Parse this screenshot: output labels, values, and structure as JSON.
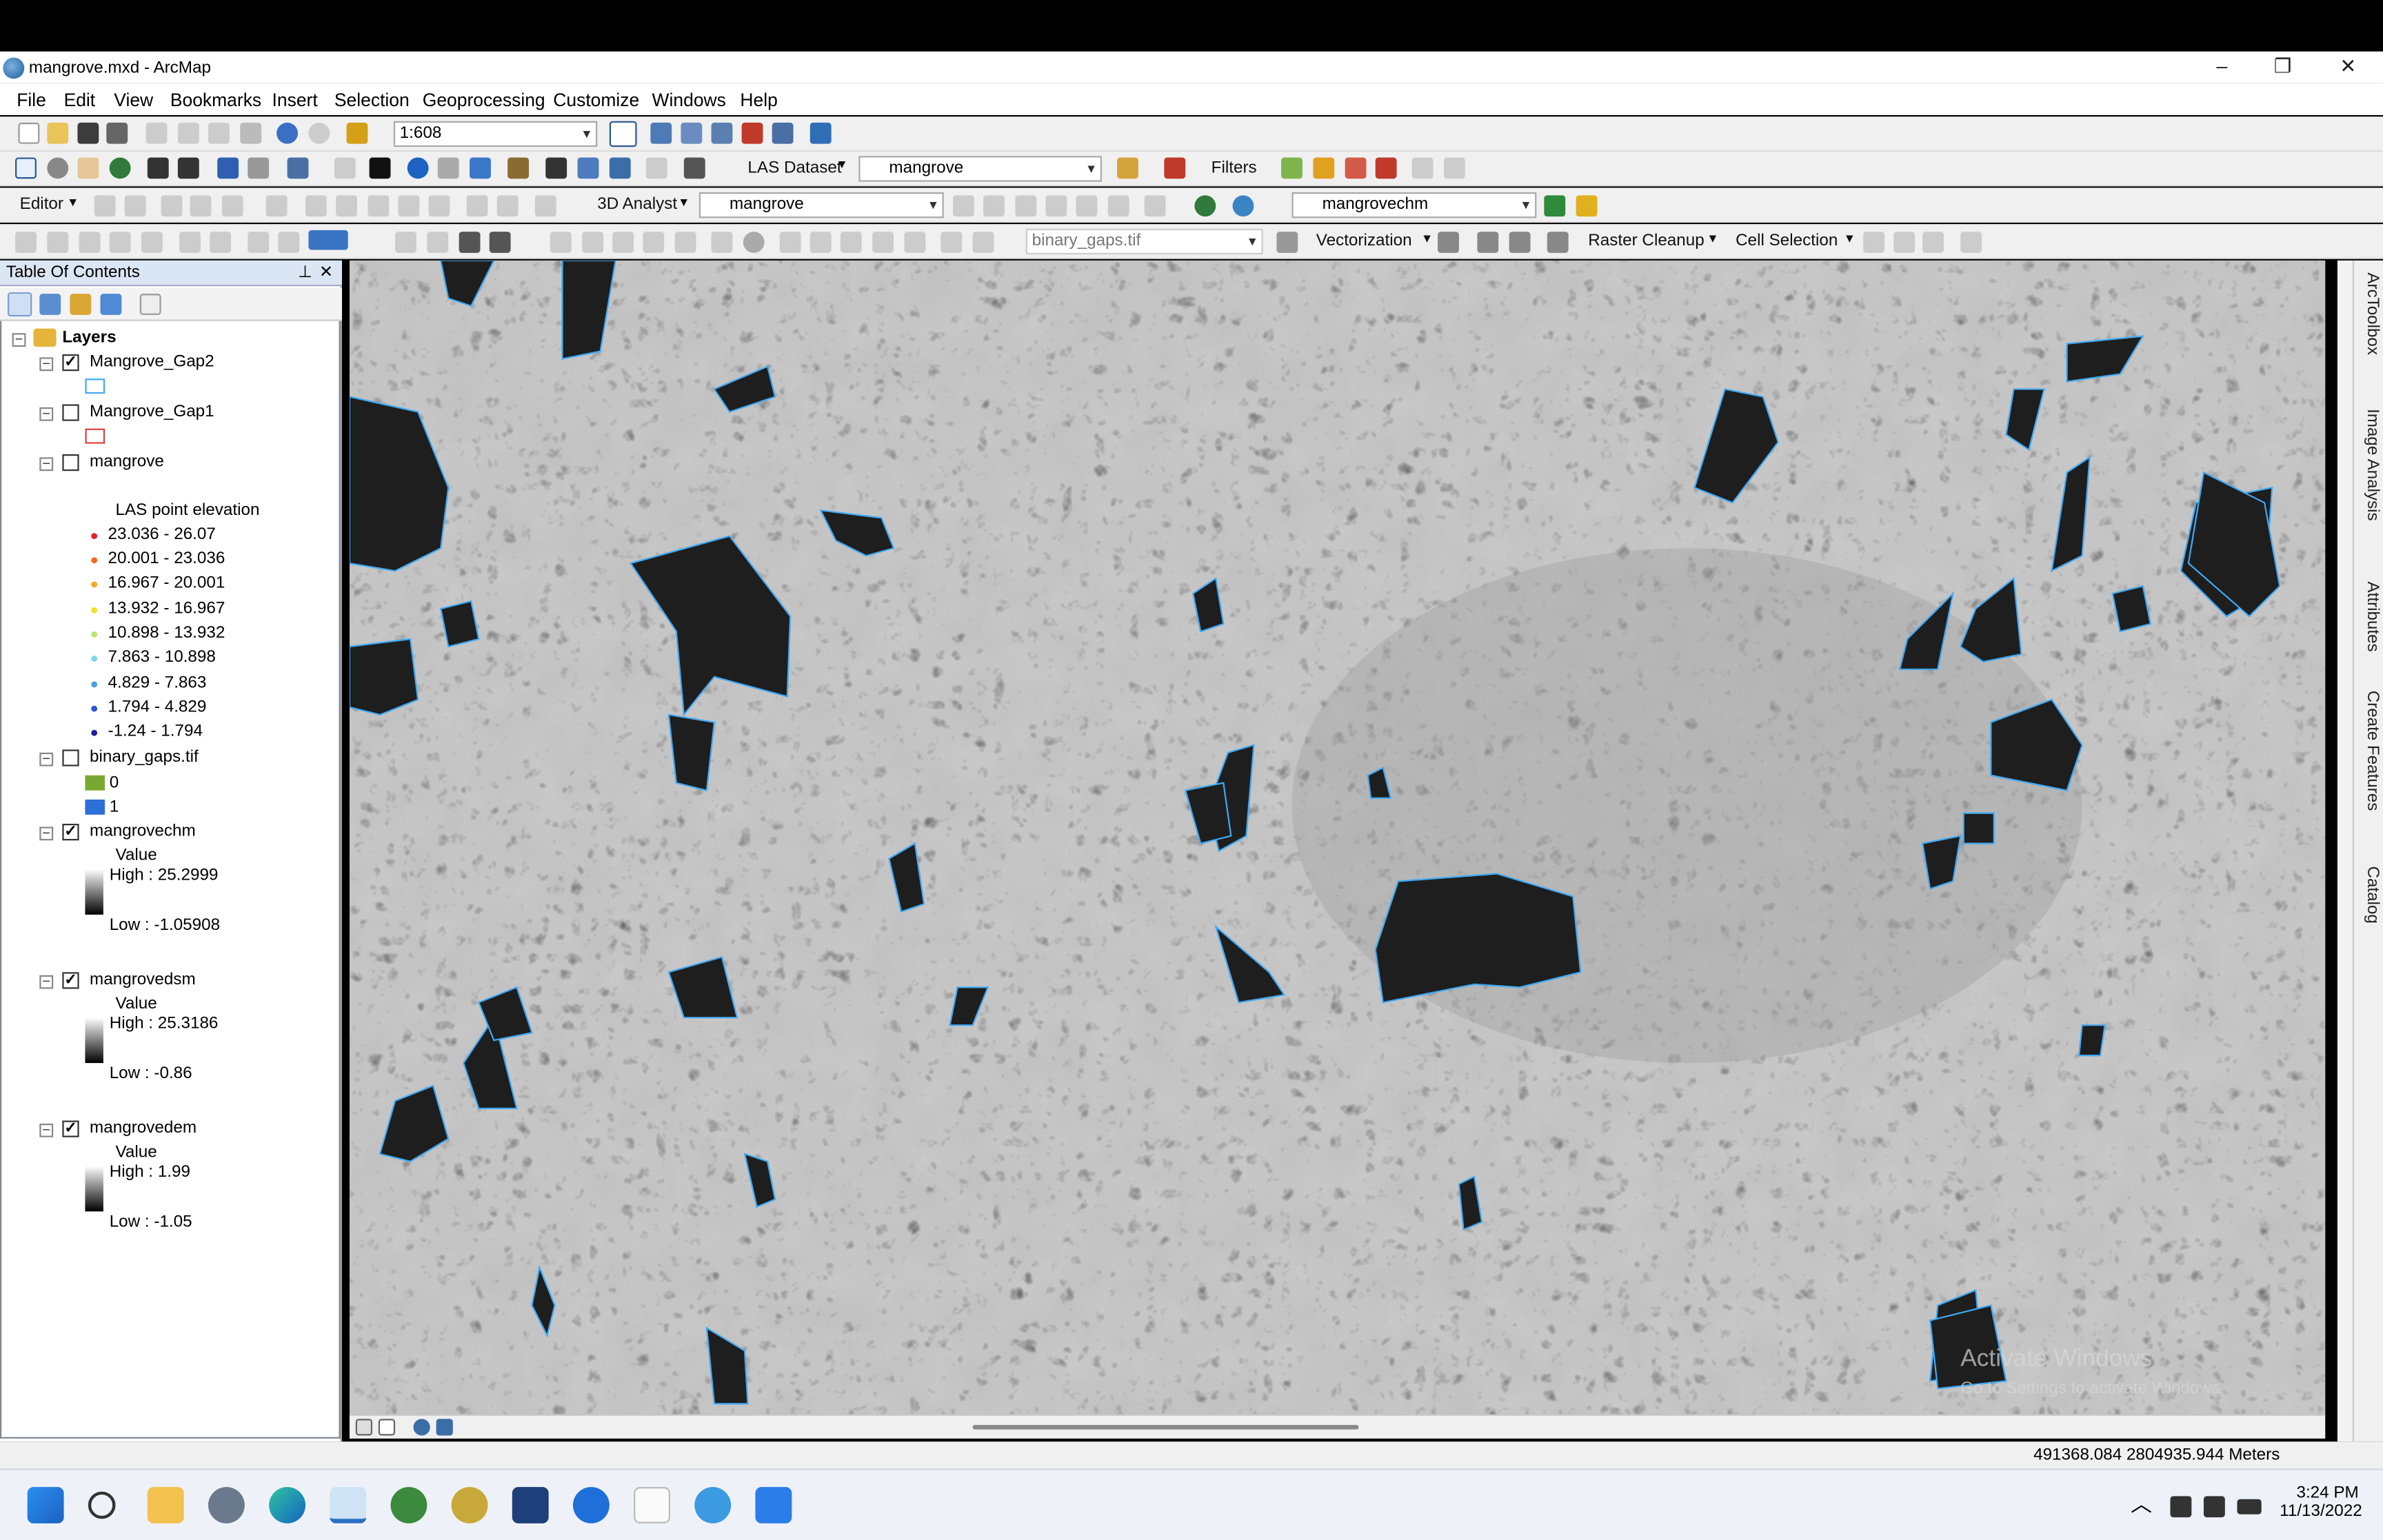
{
  "window": {
    "title": "mangrove.mxd - ArcMap",
    "minimize": "–",
    "maximize": "❐",
    "close": "✕"
  },
  "menu": [
    "File",
    "Edit",
    "View",
    "Bookmarks",
    "Insert",
    "Selection",
    "Geoprocessing",
    "Customize",
    "Windows",
    "Help"
  ],
  "toolbar1": {
    "scale": "1:608"
  },
  "toolbar2": {
    "las_dataset_label": "LAS Dataset",
    "las_dataset_value": "mangrove",
    "filters_label": "Filters"
  },
  "toolbar3": {
    "editor_label": "Editor",
    "analyst_label": "3D Analyst",
    "analyst_layer": "mangrove",
    "surface_layer": "mangrovechm"
  },
  "toolbar4": {
    "raster_layer": "binary_gaps.tif",
    "vectorization_label": "Vectorization",
    "raster_cleanup_label": "Raster Cleanup",
    "cell_selection_label": "Cell Selection"
  },
  "toc": {
    "title": "Table Of Contents",
    "root": "Layers",
    "layers": [
      {
        "name": "Mangrove_Gap2",
        "checked": true
      },
      {
        "name": "Mangrove_Gap1",
        "checked": false
      },
      {
        "name": "mangrove",
        "checked": false,
        "legend_title": "LAS point elevation",
        "classes": [
          {
            "label": "23.036 - 26.07",
            "color": "#e8202a"
          },
          {
            "label": "20.001 - 23.036",
            "color": "#f26b1d"
          },
          {
            "label": "16.967 - 20.001",
            "color": "#f7a829"
          },
          {
            "label": "13.932 - 16.967",
            "color": "#f2e02b"
          },
          {
            "label": "10.898 - 13.932",
            "color": "#b9e86b"
          },
          {
            "label": "7.863 - 10.898",
            "color": "#7fd3e8"
          },
          {
            "label": "4.829 - 7.863",
            "color": "#4aa0e0"
          },
          {
            "label": "1.794 - 4.829",
            "color": "#2a58d8"
          },
          {
            "label": "-1.24 - 1.794",
            "color": "#1a1f9a"
          }
        ]
      },
      {
        "name": "binary_gaps.tif",
        "checked": false,
        "values": [
          {
            "label": "0",
            "color": "#78a832"
          },
          {
            "label": "1",
            "color": "#2c6fd8"
          }
        ]
      },
      {
        "name": "mangrovechm",
        "checked": true,
        "value_label": "Value",
        "high": "High : 25.2999",
        "low": "Low : -1.05908"
      },
      {
        "name": "mangrovedsm",
        "checked": true,
        "value_label": "Value",
        "high": "High : 25.3186",
        "low": "Low : -0.86"
      },
      {
        "name": "mangrovedem",
        "checked": true,
        "value_label": "Value",
        "high": "High : 1.99",
        "low": "Low : -1.05"
      }
    ]
  },
  "right_dock": [
    "ArcToolbox",
    "Image Analysis",
    "Attributes",
    "Create Features",
    "Catalog"
  ],
  "status": {
    "coordinates": "491368.084  2804935.944 Meters"
  },
  "watermark": {
    "line1": "Activate Windows",
    "line2": "Go to Settings to activate Windows."
  },
  "taskbar": {
    "time": "3:24 PM",
    "date": "11/13/2022"
  },
  "colors": {
    "gap_outline": "#3fa9f5",
    "title_bg": "#ffffff",
    "toc_header": "#dbe6f4"
  }
}
